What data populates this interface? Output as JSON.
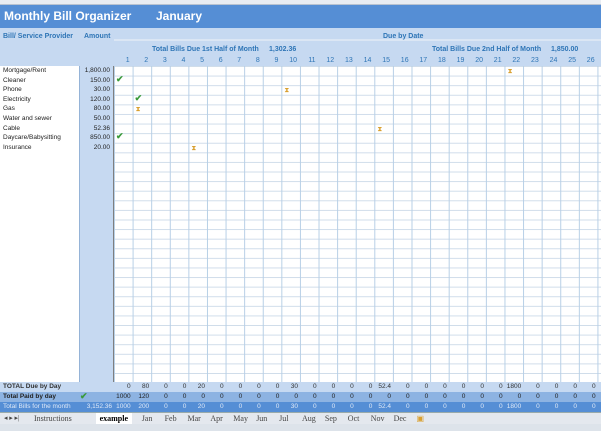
{
  "title": "Monthly Bill Organizer",
  "month": "January",
  "headers": {
    "provider": "Bill/ Service Provider",
    "amount": "Amount",
    "due_by_date": "Due by Date",
    "first_half_label": "Total Bills Due 1st Half of Month",
    "first_half_value": "1,302.36",
    "second_half_label": "Total Bills Due 2nd Half of Month",
    "second_half_value": "1,850.00"
  },
  "days": [
    "1",
    "2",
    "3",
    "4",
    "5",
    "6",
    "7",
    "8",
    "9",
    "10",
    "11",
    "12",
    "13",
    "14",
    "15",
    "16",
    "17",
    "18",
    "19",
    "20",
    "21",
    "22",
    "23",
    "24",
    "25",
    "26"
  ],
  "bills": [
    {
      "name": "Mortgage/Rent",
      "amount": "1,800.00",
      "due_day": 22
    },
    {
      "name": "Cleaner",
      "amount": "150.00",
      "paid_day": 1
    },
    {
      "name": "Phone",
      "amount": "30.00",
      "due_day": 10
    },
    {
      "name": "Electricity",
      "amount": "120.00",
      "paid_day": 2
    },
    {
      "name": "Gas",
      "amount": "80.00",
      "due_day": 2
    },
    {
      "name": "Water and sewer",
      "amount": "50.00"
    },
    {
      "name": "Cable",
      "amount": "52.36",
      "due_day": 15
    },
    {
      "name": "Daycare/Babysitting",
      "amount": "850.00",
      "paid_day": 1
    },
    {
      "name": "Insurance",
      "amount": "20.00",
      "due_day": 5
    }
  ],
  "totals": {
    "due_label": "TOTAL Due by Day",
    "due": [
      "0",
      "80",
      "0",
      "0",
      "20",
      "0",
      "0",
      "0",
      "0",
      "30",
      "0",
      "0",
      "0",
      "0",
      "52.4",
      "0",
      "0",
      "0",
      "0",
      "0",
      "0",
      "1800",
      "0",
      "0",
      "0",
      "0"
    ],
    "paid_label": "Total Paid by day",
    "paid": [
      "1000",
      "120",
      "0",
      "0",
      "0",
      "0",
      "0",
      "0",
      "0",
      "0",
      "0",
      "0",
      "0",
      "0",
      "0",
      "0",
      "0",
      "0",
      "0",
      "0",
      "0",
      "0",
      "0",
      "0",
      "0",
      "0"
    ],
    "month_label": "Total Bills for the month",
    "month_total": "3,152.36",
    "month": [
      "1000",
      "200",
      "0",
      "0",
      "20",
      "0",
      "0",
      "0",
      "0",
      "30",
      "0",
      "0",
      "0",
      "0",
      "52.4",
      "0",
      "0",
      "0",
      "0",
      "0",
      "0",
      "1800",
      "0",
      "0",
      "0",
      "0"
    ]
  },
  "sheet_tabs": [
    "Instructions",
    "example",
    "Jan",
    "Feb",
    "Mar",
    "Apr",
    "May",
    "Jun",
    "Jul",
    "Aug",
    "Sep",
    "Oct",
    "Nov",
    "Dec"
  ],
  "active_tab": "example",
  "colors": {
    "title_bar": "#558ed5",
    "header": "#c6d9f1",
    "accent_text": "#2e75b6"
  }
}
